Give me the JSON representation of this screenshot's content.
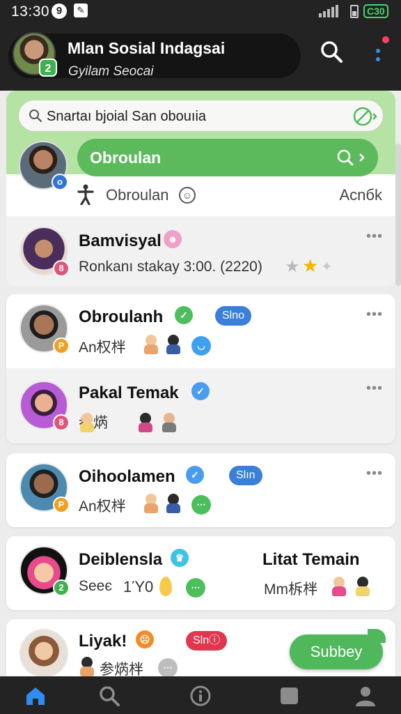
{
  "status_bar": {
    "time": "13:30",
    "badge_letter": "9",
    "battery_label": "C30"
  },
  "header": {
    "title": "Mlan Sosial Indagsai",
    "subtitle": "Gyilam Seocai",
    "profile_badge": "2"
  },
  "search": {
    "text": "Snartaı bjoial San obouıia"
  },
  "highlight": {
    "pill_label": "Obroulan",
    "tool_label": "Obroulan",
    "tool_right": "Acnбk",
    "avatar_badge": "o"
  },
  "chats": [
    {
      "name": "Bamvisyal",
      "sub": "Ronkanı stakay 3:00. (2220)",
      "avatar_badge": "8",
      "more": "•••"
    },
    {
      "name": "Obroulanh",
      "sub": "An权柈",
      "tag": "Slno",
      "avatar_badge": "P",
      "more": "•••"
    },
    {
      "name": "Pakal Temak",
      "sub": "参焫",
      "avatar_badge": "8",
      "more": "•••"
    },
    {
      "name": "Oihoolamen",
      "sub": "An权柈",
      "tag": "Slın",
      "avatar_badge": "P",
      "more": "•••"
    },
    {
      "name": "Deiblensla",
      "sub": "Seeє",
      "sub_count": "1Ύ0",
      "right_name": "Litat Temain",
      "right_sub": "Mm柝柈",
      "avatar_badge": "2"
    },
    {
      "name": "Liyak!",
      "sub": "参焫柈",
      "tag": "Slnⓘ"
    }
  ],
  "fab": {
    "label": "Subbey"
  },
  "nav": [
    "home-icon",
    "search-icon",
    "info-icon",
    "square-icon",
    "profile-icon"
  ],
  "colors": {
    "accent_green": "#5cba5c",
    "panel_green": "#b5e3a4",
    "tag_blue": "#3a7fd9",
    "tag_red": "#e0364f",
    "nav_active": "#2f8cf0"
  }
}
